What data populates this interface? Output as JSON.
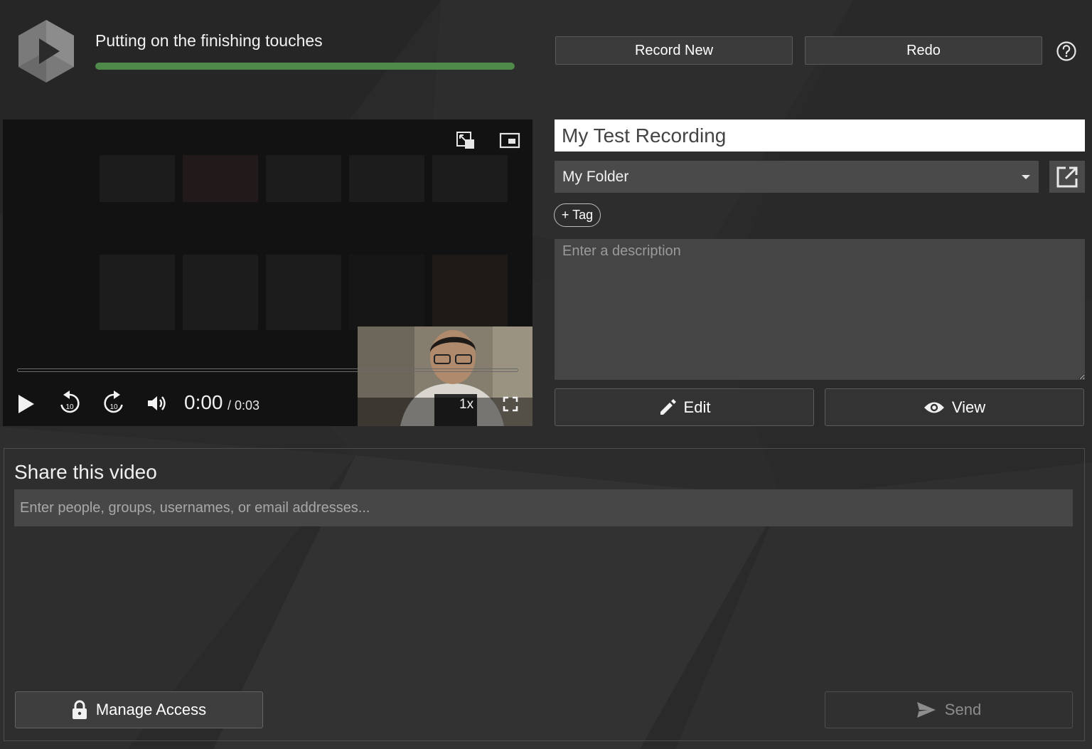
{
  "header": {
    "status_text": "Putting on the finishing touches",
    "progress": 1.0,
    "record_new_label": "Record New",
    "redo_label": "Redo",
    "help_icon": "help-circle-icon"
  },
  "player": {
    "current_time": "0:00",
    "duration_text": "/ 0:03",
    "speed_label": "1x",
    "seek_progress": 0.0
  },
  "form": {
    "title_value": "My Test Recording",
    "folder_value": "My Folder",
    "tag_label": "+ Tag",
    "description_placeholder": "Enter a description",
    "edit_label": "Edit",
    "view_label": "View"
  },
  "share": {
    "title": "Share this video",
    "input_placeholder": "Enter people, groups, usernames, or email addresses...",
    "manage_access_label": "Manage Access",
    "send_label": "Send"
  },
  "colors": {
    "background": "#2b2b2b",
    "progress_green": "#4f8a4b",
    "button_bg": "#3b3b3b"
  }
}
